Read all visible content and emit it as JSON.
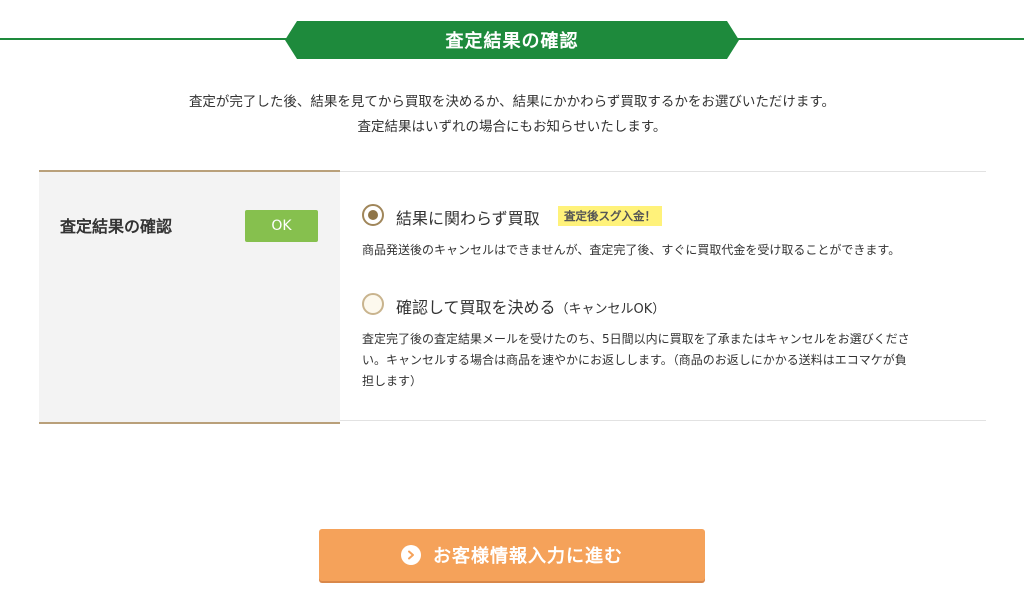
{
  "header": {
    "title": "査定結果の確認"
  },
  "intro": {
    "line1": "査定が完了した後、結果を見てから買取を決めるか、結果にかかわらず買取するかをお選びいただけます。",
    "line2": "査定結果はいずれの場合にもお知らせいたします。"
  },
  "section": {
    "label": "査定結果の確認",
    "status_badge": "OK",
    "options": [
      {
        "title": "結果に関わらず買取",
        "badge": "査定後スグ入金！",
        "selected": true,
        "description": "商品発送後のキャンセルはできませんが、査定完了後、すぐに買取代金を受け取ることができます。"
      },
      {
        "title": "確認して買取を決める",
        "suffix": "（キャンセルOK）",
        "selected": false,
        "description_lines": [
          "査定完了後の査定結果メールを受けたのち、5日間以内に買取を了承またはキャンセルをお選びくださ",
          "い。キャンセルする場合は商品を速やかにお返しします。（商品のお返しにかかる送料はエコマケが負",
          "担します）"
        ]
      }
    ]
  },
  "cta": {
    "label": "お客様情報入力に進む",
    "icon": "chevron-right-circle-icon"
  },
  "colors": {
    "brand_green": "#1e8a3c",
    "ok_green": "#86c04e",
    "cta_orange": "#f5a25a",
    "promo_yellow": "#fff27a",
    "radio_brown": "#8f7548"
  }
}
